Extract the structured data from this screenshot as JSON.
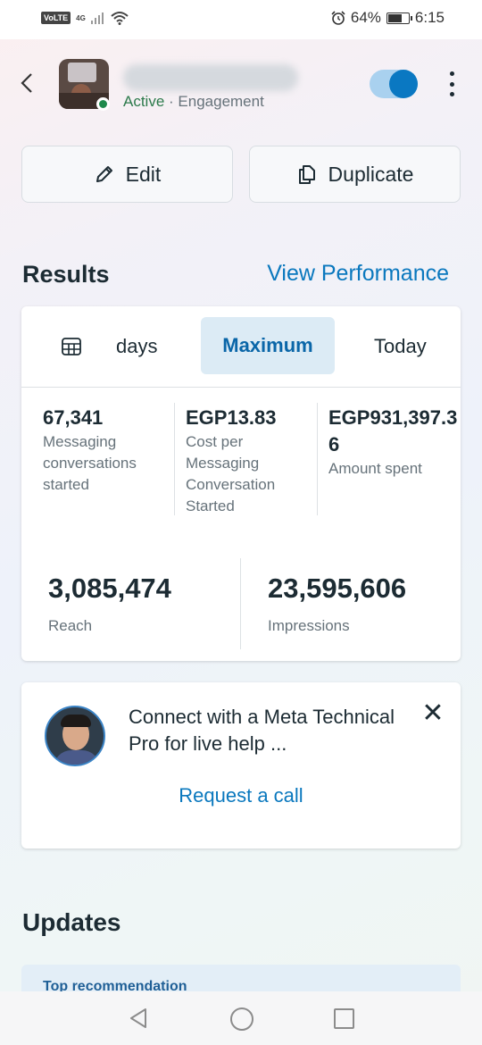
{
  "status_bar": {
    "volte": "VoLTE",
    "network": "4G",
    "battery": "64%",
    "battery_level": 0.64,
    "time": "6:15"
  },
  "header": {
    "status_active": "Active",
    "separator": " · ",
    "status_type": "Engagement",
    "toggle_on": true
  },
  "actions": {
    "edit_label": "Edit",
    "duplicate_label": "Duplicate"
  },
  "results": {
    "title": "Results",
    "view_performance": "View Performance",
    "tabs": {
      "days": "days",
      "maximum": "Maximum",
      "today": "Today"
    },
    "metrics": [
      {
        "value": "67,341",
        "label": "Messaging conversations started"
      },
      {
        "value": "EGP13.83",
        "label": "Cost per Messaging Conversation Started"
      },
      {
        "value": "EGP931,397.36",
        "label": "Amount spent"
      }
    ],
    "reach": {
      "value": "3,085,474",
      "label": "Reach"
    },
    "impressions": {
      "value": "23,595,606",
      "label": "Impressions"
    }
  },
  "connect": {
    "text": "Connect with a Meta Technical Pro for live help ...",
    "close": "✕",
    "request_call": "Request a call"
  },
  "updates": {
    "title": "Updates",
    "top_recommendation": "Top recommendation"
  },
  "colors": {
    "accent": "#0a78be",
    "active_green": "#2c7a4b",
    "selected_tab_bg": "#dcebf5"
  }
}
